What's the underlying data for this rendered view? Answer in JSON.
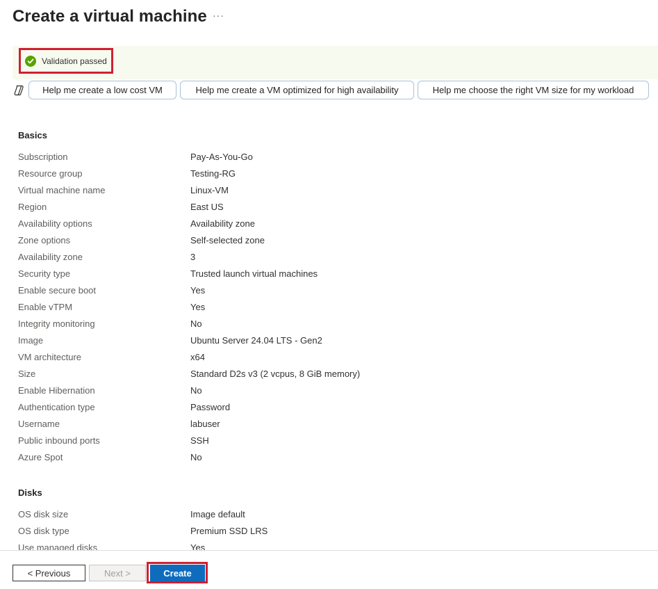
{
  "header": {
    "title": "Create a virtual machine",
    "more": "···"
  },
  "validation": {
    "text": "Validation passed",
    "color": "#57a300"
  },
  "copilot": {
    "icon": "copilot-icon",
    "suggestions": [
      "Help me create a low cost VM",
      "Help me create a VM optimized for high availability",
      "Help me choose the right VM size for my workload"
    ]
  },
  "sections": {
    "basics": {
      "title": "Basics",
      "rows": [
        {
          "label": "Subscription",
          "value": "Pay-As-You-Go"
        },
        {
          "label": "Resource group",
          "value": "Testing-RG"
        },
        {
          "label": "Virtual machine name",
          "value": "Linux-VM"
        },
        {
          "label": "Region",
          "value": "East US"
        },
        {
          "label": "Availability options",
          "value": "Availability zone"
        },
        {
          "label": "Zone options",
          "value": "Self-selected zone"
        },
        {
          "label": "Availability zone",
          "value": "3"
        },
        {
          "label": "Security type",
          "value": "Trusted launch virtual machines"
        },
        {
          "label": "Enable secure boot",
          "value": "Yes"
        },
        {
          "label": "Enable vTPM",
          "value": "Yes"
        },
        {
          "label": "Integrity monitoring",
          "value": "No"
        },
        {
          "label": "Image",
          "value": "Ubuntu Server 24.04 LTS - Gen2"
        },
        {
          "label": "VM architecture",
          "value": "x64"
        },
        {
          "label": "Size",
          "value": "Standard D2s v3 (2 vcpus, 8 GiB memory)"
        },
        {
          "label": "Enable Hibernation",
          "value": "No"
        },
        {
          "label": "Authentication type",
          "value": "Password"
        },
        {
          "label": "Username",
          "value": "labuser"
        },
        {
          "label": "Public inbound ports",
          "value": "SSH"
        },
        {
          "label": "Azure Spot",
          "value": "No"
        }
      ]
    },
    "disks": {
      "title": "Disks",
      "rows": [
        {
          "label": "OS disk size",
          "value": "Image default"
        },
        {
          "label": "OS disk type",
          "value": "Premium SSD LRS"
        },
        {
          "label": "Use managed disks",
          "value": "Yes"
        }
      ]
    }
  },
  "footer": {
    "previous": "< Previous",
    "next": "Next >",
    "create": "Create",
    "accent": "#0f6cbd"
  }
}
